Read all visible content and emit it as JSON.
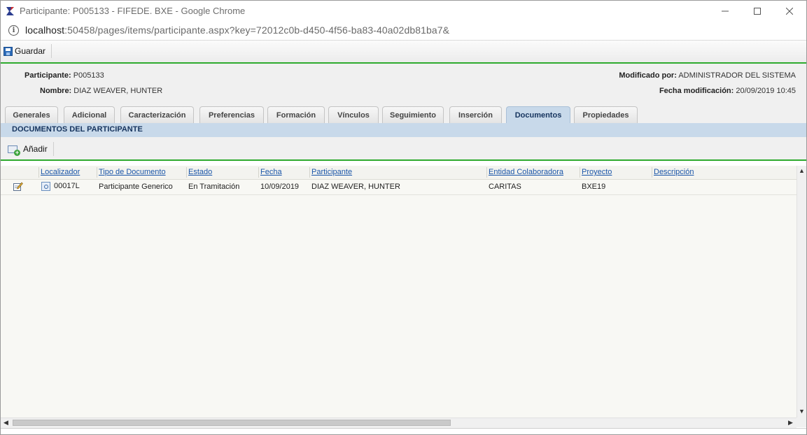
{
  "window": {
    "title": "Participante: P005133 - FIFEDE. BXE - Google Chrome",
    "url_host": "localhost",
    "url_rest": ":50458/pages/items/participante.aspx?key=72012c0b-d450-4f56-ba83-40a02db81ba7&"
  },
  "toolbar": {
    "save_label": "Guardar"
  },
  "header": {
    "participante_label": "Participante:",
    "participante_value": "P005133",
    "nombre_label": "Nombre:",
    "nombre_value": "DIAZ WEAVER, HUNTER",
    "modificado_label": "Modificado por:",
    "modificado_value": "ADMINISTRADOR DEL SISTEMA",
    "fecha_label": "Fecha modificación:",
    "fecha_value": "20/09/2019 10:45"
  },
  "tabs": [
    {
      "label": "Generales"
    },
    {
      "label": "Adicional"
    },
    {
      "label": "Caracterización"
    },
    {
      "label": "Preferencias"
    },
    {
      "label": "Formación"
    },
    {
      "label": "Vínculos"
    },
    {
      "label": "Seguimiento"
    },
    {
      "label": "Inserción"
    },
    {
      "label": "Documentos",
      "active": true
    },
    {
      "label": "Propiedades"
    }
  ],
  "section": {
    "title": "DOCUMENTOS DEL PARTICIPANTE",
    "add_label": "Añadir"
  },
  "grid": {
    "columns": [
      "Localizador",
      "Tipo de Documento",
      "Estado",
      "Fecha",
      "Participante",
      "Entidad Colaboradora",
      "Proyecto",
      "Descripción"
    ],
    "rows": [
      {
        "localizador": "00017L",
        "tipo": "Participante Generico",
        "estado": "En Tramitación",
        "fecha": "10/09/2019",
        "participante": "DIAZ WEAVER, HUNTER",
        "entidad": "CARITAS",
        "proyecto": "BXE19",
        "descripcion": ""
      }
    ]
  }
}
